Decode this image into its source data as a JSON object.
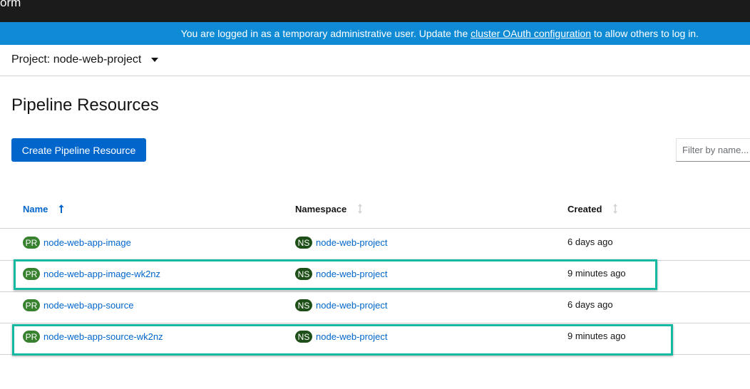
{
  "topbar": {
    "brand_fragment": "orm"
  },
  "banner": {
    "text_before": "You are logged in as a temporary administrative user. Update the ",
    "link": "cluster OAuth configuration",
    "text_after": " to allow others to log in."
  },
  "project": {
    "label": "Project: node-web-project"
  },
  "page": {
    "title": "Pipeline Resources"
  },
  "toolbar": {
    "create_label": "Create Pipeline Resource",
    "filter_placeholder": "Filter by name..."
  },
  "table": {
    "columns": [
      {
        "label": "Name",
        "sort": "ascending"
      },
      {
        "label": "Namespace",
        "sort": "none"
      },
      {
        "label": "Created",
        "sort": "none"
      }
    ],
    "rows": [
      {
        "kind_badge": "PR",
        "name": "node-web-app-image",
        "ns_badge": "NS",
        "namespace": "node-web-project",
        "created": "6 days ago",
        "highlighted": false
      },
      {
        "kind_badge": "PR",
        "name": "node-web-app-image-wk2nz",
        "ns_badge": "NS",
        "namespace": "node-web-project",
        "created": "9 minutes ago",
        "highlighted": true
      },
      {
        "kind_badge": "PR",
        "name": "node-web-app-source",
        "ns_badge": "NS",
        "namespace": "node-web-project",
        "created": "6 days ago",
        "highlighted": false
      },
      {
        "kind_badge": "PR",
        "name": "node-web-app-source-wk2nz",
        "ns_badge": "NS",
        "namespace": "node-web-project",
        "created": "9 minutes ago",
        "highlighted": true
      }
    ]
  },
  "colors": {
    "banner": "#0f8bd6",
    "primary": "#0066cc",
    "pr_badge": "#38812f",
    "ns_badge": "#1e4f18",
    "highlight": "#15b8a0"
  }
}
